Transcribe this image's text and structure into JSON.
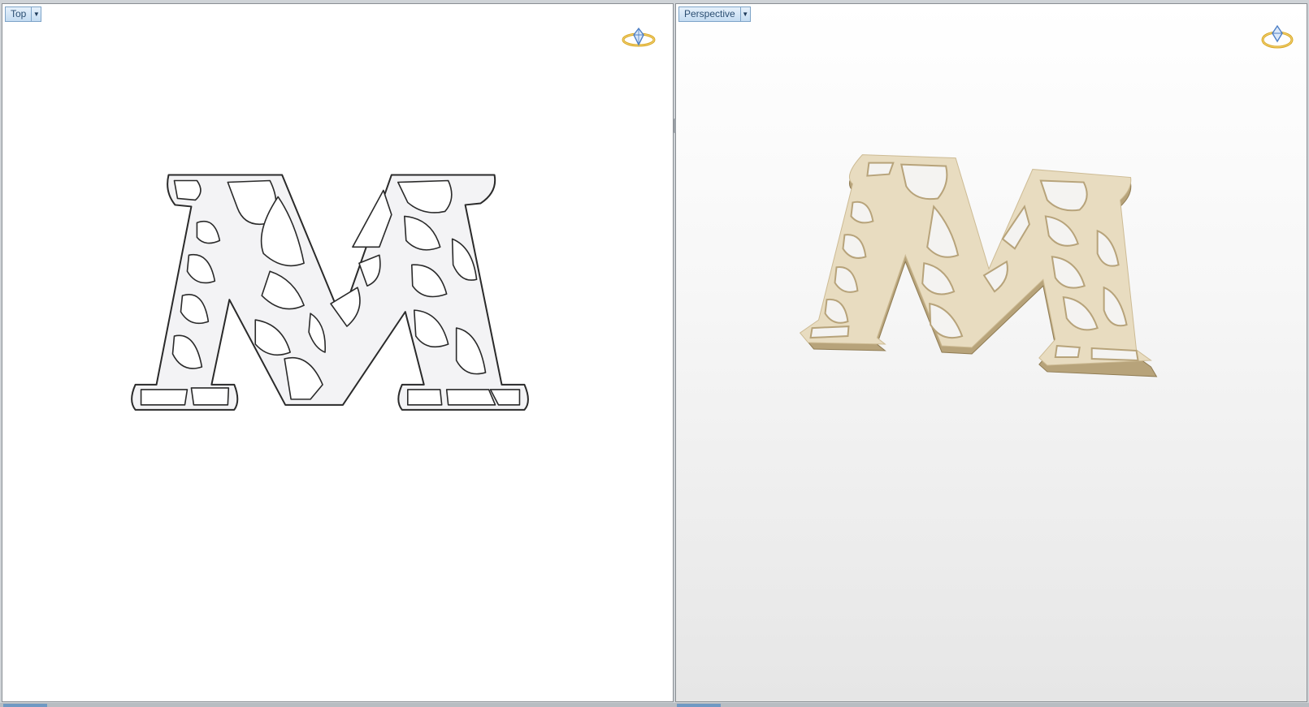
{
  "viewports": {
    "top": {
      "label": "Top",
      "dropdown_icon": "chevron-down-icon"
    },
    "perspective": {
      "label": "Perspective",
      "dropdown_icon": "chevron-down-icon"
    }
  },
  "icons": {
    "gem_ring": "diamond-ring-icon"
  },
  "colors": {
    "outline": "#2a2a2a",
    "top_fill": "#f3f3f5",
    "model_face": "#e8dcc0",
    "model_side": "#b7a37a",
    "label_bg": "#cfe3f6",
    "ring_gold": "#d9a521",
    "gem_blue": "#4f80c6"
  }
}
